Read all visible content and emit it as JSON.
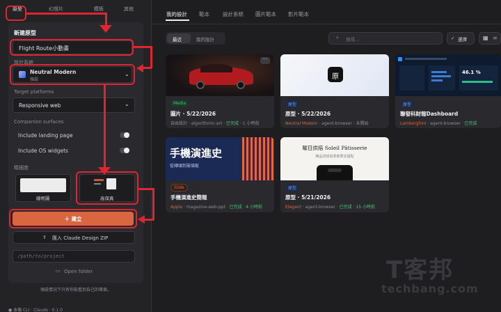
{
  "left_tabs": [
    "原型",
    "幻燈片",
    "模板",
    "其他"
  ],
  "panel": {
    "new_title": "新建原型",
    "name_value": "Flight Route小動畫",
    "design_system_label": "設計系統",
    "design_system_name": "Neutral Modern",
    "design_system_sub": "預設",
    "platforms_label": "Target platforms",
    "platform_value": "Responsive web",
    "companion_label": "Companion surfaces",
    "landing": "Include landing page",
    "widgets": "Include OS widgets",
    "fidelity_label": "精細度",
    "wireframe": "線框圖",
    "hifi": "高保真",
    "create": "＋ 建立",
    "import": "匯入 Claude Design ZIP",
    "path_placeholder": "/path/to/project",
    "open_folder": "Open folder",
    "footer_note": "預設情況下只有你能看到自己的專案。"
  },
  "status_bar": "● 本機 CLI · Claude · 0.1.0",
  "main": {
    "tabs": [
      "我的設計",
      "範本",
      "設計系統",
      "圖片範本",
      "影片範本"
    ],
    "subtabs": [
      "最近",
      "我的設計"
    ],
    "search_placeholder": "搜尋…",
    "select_label": "選擇",
    "cards": [
      {
        "badge": "Media",
        "title": "圖片 · 5/22/2026",
        "meta_a": "自由設計 · algorithmic-art · ",
        "meta_b": "已完成",
        "meta_c": " · 1 小時前"
      },
      {
        "badge": "原型",
        "title": "原型 · 5/22/2026",
        "meta_a": "Neutral Modern",
        "meta_b": " · agent-browser · 未開始",
        "meta_c": ""
      },
      {
        "badge": "原型",
        "title": "聯發科財報Dashboard",
        "meta_a": "Lamborghini",
        "meta_b": " · agent-browser · ",
        "meta_c": "已完成"
      },
      {
        "badge": "Slide",
        "title": "手機演進史簡報",
        "meta_a": "Apple",
        "meta_b": " · magazine-web-ppt · ",
        "meta_c": "已完成 · 4 小時前"
      },
      {
        "badge": "原型",
        "title": "原型 · 5/21/2026",
        "meta_a": "Elegant",
        "meta_b": " · agent-browser · ",
        "meta_c": "已完成 · 15 小時前"
      }
    ],
    "thumb_text": {
      "logo": "原",
      "slide_title": "手機演進史",
      "slide_sub": "從磚頭到玻璃板",
      "bakery_title": "曜日烘焙 Soleil Pâtisserie",
      "bakery_sub": "精品烘焙與季節限定甜點",
      "dash_value": "46.1 %"
    }
  },
  "watermark": {
    "brand": "T客邦",
    "url": "techbang.com"
  },
  "colors": {
    "accent": "#d9663e",
    "annot": "#e02530",
    "badge_blue": "#5b8def"
  }
}
